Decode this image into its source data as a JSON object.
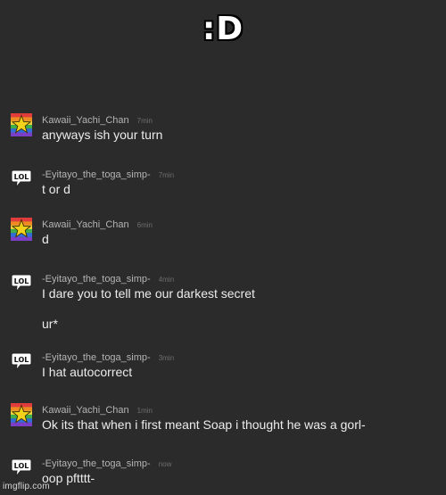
{
  "caption": ":D",
  "messages": [
    {
      "user": "Kawaii_Yachi_Chan",
      "time": "7min",
      "avatar": "rainbow-star-icon",
      "lines": [
        "anyways ish your turn"
      ]
    },
    {
      "user": "-Eyitayo_the_toga_simp-",
      "time": "7min",
      "avatar": "lol-speech-bubble-icon",
      "lines": [
        "t or d"
      ]
    },
    {
      "user": "Kawaii_Yachi_Chan",
      "time": "6min",
      "avatar": "rainbow-star-icon",
      "lines": [
        "d"
      ]
    },
    {
      "user": "-Eyitayo_the_toga_simp-",
      "time": "4min",
      "avatar": "lol-speech-bubble-icon",
      "lines": [
        "I dare you to tell me our darkest secret",
        "ur*"
      ]
    },
    {
      "user": "-Eyitayo_the_toga_simp-",
      "time": "3min",
      "avatar": "lol-speech-bubble-icon",
      "lines": [
        "I hat autocorrect"
      ]
    },
    {
      "user": "Kawaii_Yachi_Chan",
      "time": "1min",
      "avatar": "rainbow-star-icon",
      "lines": [
        "Ok its that when i first meant Soap i thought he was a gorl-"
      ]
    },
    {
      "user": "-Eyitayo_the_toga_simp-",
      "time": "now",
      "avatar": "lol-speech-bubble-icon",
      "lines": [
        "oop pftttt-"
      ]
    }
  ],
  "avatars": {
    "lol_label": "LOL"
  },
  "colors": {
    "background": "#2b2b2b",
    "username": "#b4b4b4",
    "timestamp": "#6e6e6e",
    "message_text": "#ececec",
    "star": "#f3d21b"
  },
  "watermark": "imgflip.com"
}
